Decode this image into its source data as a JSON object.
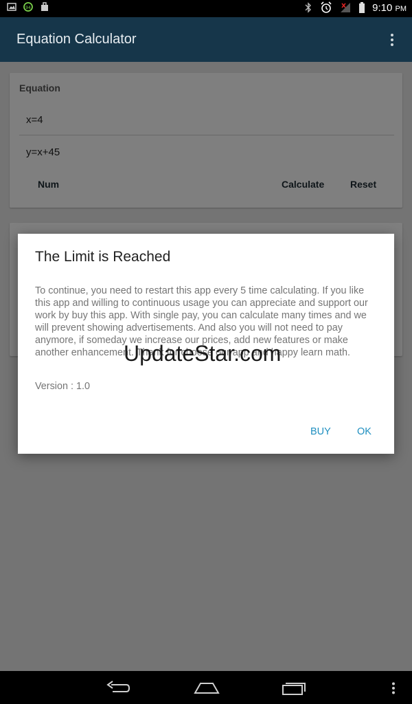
{
  "status_bar": {
    "time": "9:10",
    "time_suffix": "PM",
    "icons": [
      "image-icon",
      "badge-icon",
      "bag-icon",
      "bluetooth-icon",
      "alarm-icon",
      "no-signal-icon",
      "battery-icon"
    ]
  },
  "app_bar": {
    "title": "Equation Calculator"
  },
  "equation_card": {
    "label": "Equation",
    "field1": "x=4",
    "field2": "y=x+45",
    "buttons": {
      "num": "Num",
      "calculate": "Calculate",
      "reset": "Reset"
    }
  },
  "dialog": {
    "title": "The Limit is Reached",
    "message": "To continue, you need to restart this app every 5 time calculating. If you like this app and willing to continuous usage you can appreciate and support our work by buy this app. With single pay, you can calculate many times and we will prevent showing advertisements. And also you will not need to pay anymore, if someday we increase our prices, add new features or make another enhancement. Thank for choose our app and happy learn math.",
    "version": "Version : 1.0",
    "buttons": {
      "buy": "BUY",
      "ok": "OK"
    }
  },
  "watermark": "UpdateStar.com",
  "colors": {
    "app_bar": "#16364a",
    "accent": "#1f8fc0"
  }
}
